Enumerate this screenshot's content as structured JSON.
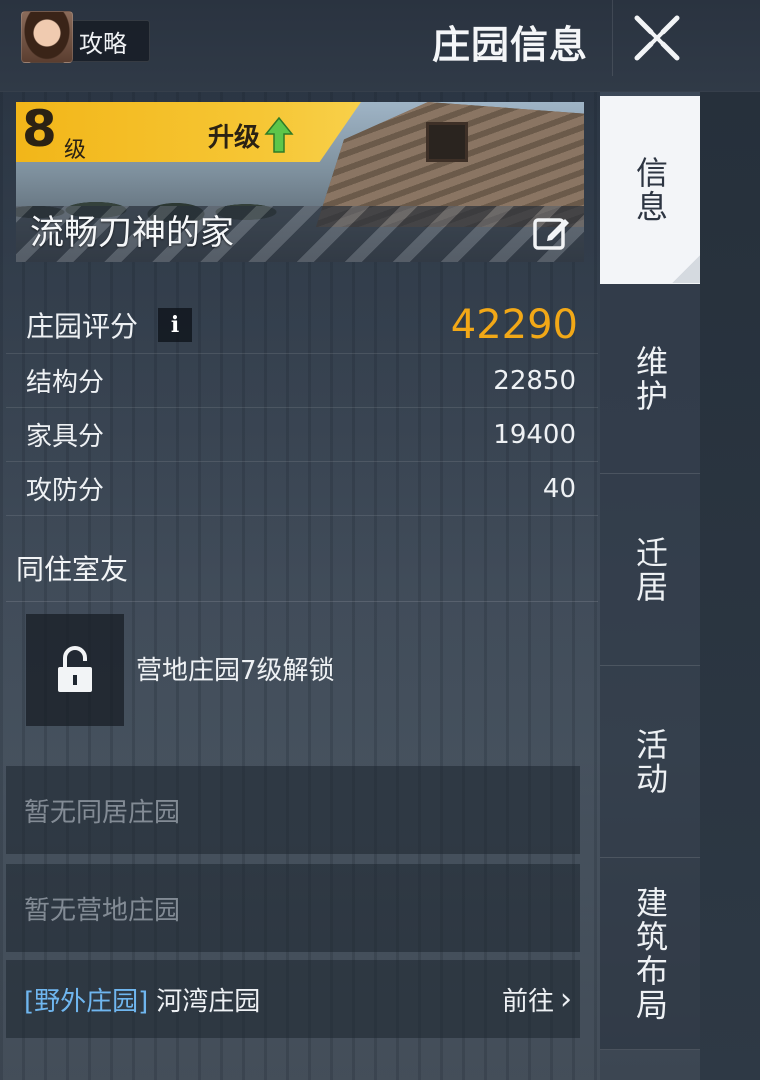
{
  "header": {
    "guide_label": "攻略",
    "title": "庄园信息"
  },
  "home": {
    "level": "8",
    "level_unit": "级",
    "upgrade_label": "升级",
    "name": "流畅刀神的家"
  },
  "stats": {
    "score_label": "庄园评分",
    "score_info": "i",
    "score_value": "42290",
    "rows": [
      {
        "label": "结构分",
        "value": "22850"
      },
      {
        "label": "家具分",
        "value": "19400"
      },
      {
        "label": "攻防分",
        "value": "40"
      }
    ]
  },
  "roommates": {
    "title": "同住室友",
    "lock_text": "营地庄园7级解锁"
  },
  "estates": {
    "no_cohabit": "暂无同居庄园",
    "no_camp": "暂无营地庄园",
    "wild_tag": "[野外庄园]",
    "wild_name": "河湾庄园",
    "goto_label": "前往",
    "goto_arrow": "›"
  },
  "tabs": [
    {
      "label": "信息",
      "active": true
    },
    {
      "label": "维护",
      "active": false
    },
    {
      "label": "迁居",
      "active": false
    },
    {
      "label": "活动",
      "active": false
    },
    {
      "label": "建筑布局",
      "active": false
    }
  ],
  "colors": {
    "accent_gold": "#f2a817",
    "level_yellow": "#f2b619",
    "upgrade_arrow": "#5cc64a",
    "link_blue": "#6fb6ef"
  },
  "icons": [
    "avatar",
    "close-icon",
    "upgrade-arrow-icon",
    "edit-icon",
    "info-icon",
    "lock-icon",
    "chevron-right-icon"
  ]
}
